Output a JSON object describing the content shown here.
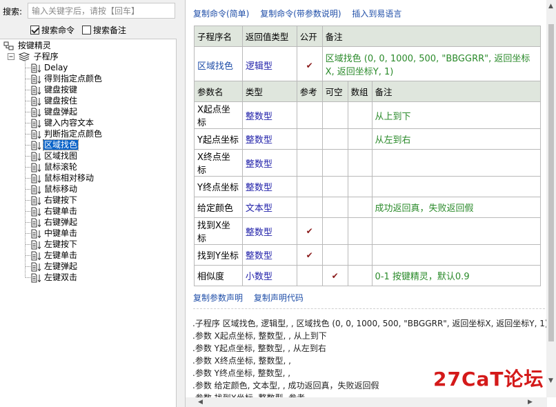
{
  "search": {
    "label": "搜索:",
    "placeholder": "输入关键字后，请按【回车】",
    "checkboxes": [
      {
        "label": "搜索命令",
        "checked": true
      },
      {
        "label": "搜索备注",
        "checked": false
      }
    ]
  },
  "tree": {
    "root": "按键精灵",
    "group": "子程序",
    "items": [
      "Delay",
      "得到指定点颜色",
      "键盘按键",
      "键盘按住",
      "键盘弹起",
      "键入内容文本",
      "判断指定点颜色",
      "区域找色",
      "区域找图",
      "鼠标滚轮",
      "鼠标相对移动",
      "鼠标移动",
      "右键按下",
      "右键单击",
      "右键弹起",
      "中键单击",
      "左键按下",
      "左键单击",
      "左键弹起",
      "左键双击"
    ],
    "selected_index": 7
  },
  "top_links": [
    "复制命令(简单)",
    "复制命令(带参数说明)",
    "插入到易语言"
  ],
  "sub_table": {
    "headers": [
      "子程序名",
      "返回值类型",
      "公开",
      "备注"
    ],
    "row": {
      "name": "区域找色",
      "type": "逻辑型",
      "public": "✔",
      "note": "区域找色 (0, 0, 1000, 500, \"BBGGRR\", 返回坐标X, 返回坐标Y, 1)"
    }
  },
  "param_table": {
    "headers": [
      "参数名",
      "类型",
      "参考",
      "可空",
      "数组",
      "备注"
    ],
    "rows": [
      {
        "name": "X起点坐标",
        "type": "整数型",
        "ref": "",
        "nullable": "",
        "array": "",
        "note": "从上到下"
      },
      {
        "name": "Y起点坐标",
        "type": "整数型",
        "ref": "",
        "nullable": "",
        "array": "",
        "note": "从左到右"
      },
      {
        "name": "X终点坐标",
        "type": "整数型",
        "ref": "",
        "nullable": "",
        "array": "",
        "note": ""
      },
      {
        "name": "Y终点坐标",
        "type": "整数型",
        "ref": "",
        "nullable": "",
        "array": "",
        "note": ""
      },
      {
        "name": "给定颜色",
        "type": "文本型",
        "ref": "",
        "nullable": "",
        "array": "",
        "note": "成功返回真，失败返回假"
      },
      {
        "name": "找到X坐标",
        "type": "整数型",
        "ref": "✔",
        "nullable": "",
        "array": "",
        "note": ""
      },
      {
        "name": "找到Y坐标",
        "type": "整数型",
        "ref": "✔",
        "nullable": "",
        "array": "",
        "note": ""
      },
      {
        "name": "相似度",
        "type": "小数型",
        "ref": "",
        "nullable": "✔",
        "array": "",
        "note": "0-1 按键精灵，默认0.9"
      }
    ]
  },
  "bottom_links": [
    "复制参数声明",
    "复制声明代码"
  ],
  "code_lines": [
    ".子程序 区域找色, 逻辑型, , 区域找色 (0, 0, 1000, 500, \"BBGGRR\", 返回坐标X, 返回坐标Y, 1)",
    ".参数 X起点坐标, 整数型, , 从上到下",
    ".参数 Y起点坐标, 整数型, , 从左到右",
    ".参数 X终点坐标, 整数型, ,",
    ".参数 Y终点坐标, 整数型, ,",
    ".参数 给定颜色, 文本型, , 成功返回真，失败返回假",
    ".参数 找到X坐标, 整数型, 参考"
  ],
  "watermark": "27CaT论坛",
  "colors": {
    "selection": "#0a63c9",
    "link": "#1f4ea8",
    "type": "#2222aa",
    "note": "#2a8a2a",
    "header_bg": "#dfe6dd"
  }
}
